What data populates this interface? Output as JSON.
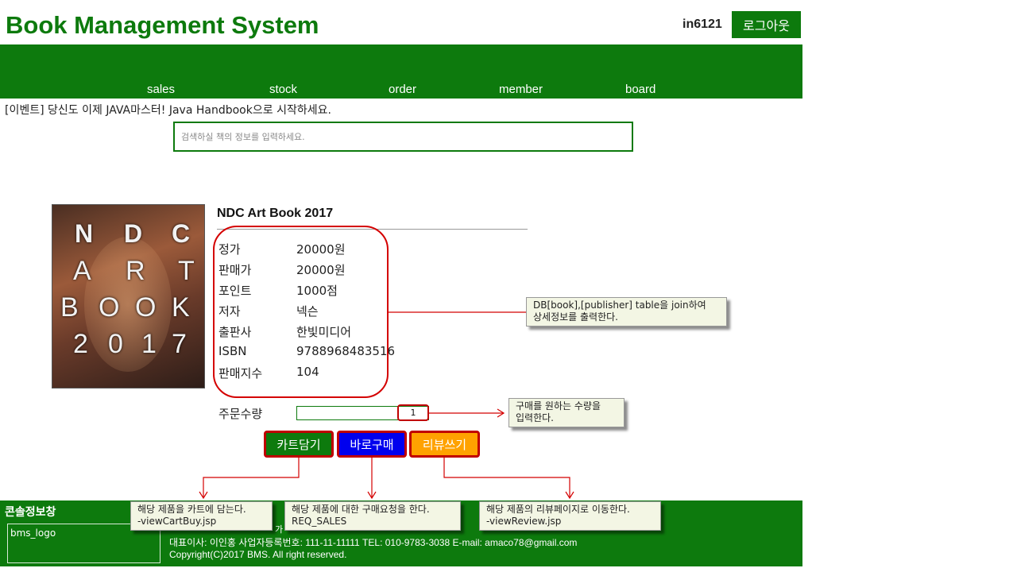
{
  "header": {
    "title": "Book Management System",
    "user_id": "in6121",
    "logout_label": "로그아웃"
  },
  "nav": {
    "items": [
      "sales",
      "stock",
      "order",
      "member",
      "board"
    ]
  },
  "event_banner": "[이벤트] 당신도 이제 JAVA마스터! Java Handbook으로 시작하세요.",
  "search": {
    "placeholder": "검색하실 책의 정보를 입력하세요."
  },
  "book": {
    "cover_letters": [
      "N",
      "D",
      "C",
      "A",
      "R",
      "T",
      "B",
      "O",
      "O",
      "K",
      "2",
      "0",
      "1",
      "7"
    ],
    "title": "NDC Art Book 2017",
    "fields": [
      {
        "label": "정가",
        "value": "20000원"
      },
      {
        "label": "판매가",
        "value": "20000원"
      },
      {
        "label": "포인트",
        "value": "1000점"
      },
      {
        "label": "저자",
        "value": "넥슨"
      },
      {
        "label": "출판사",
        "value": "한빛미디어"
      },
      {
        "label": "ISBN",
        "value": "9788968483516"
      },
      {
        "label": "판매지수",
        "value": "104"
      }
    ],
    "qty_label": "주문수량",
    "qty_value": "1"
  },
  "buttons": {
    "cart": "카트담기",
    "buy": "바로구매",
    "review": "리뷰쓰기"
  },
  "annotations": {
    "db_note_1": "DB[book],[publisher] table을 join하여",
    "db_note_2": "상세정보를 출력한다.",
    "qty_note_1": "구매를 원하는 수량을",
    "qty_note_2": "입력한다.",
    "cart_note_1": "해당 제품을 카트에 담는다.",
    "cart_note_2": "-viewCartBuy.jsp",
    "buy_note_1": "해당 제품에 대한 구매요청을 한다.",
    "buy_note_2": "REQ_SALES",
    "review_note_1": "해당 제품의 리뷰페이지로 이동한다.",
    "review_note_2": "-viewReview.jsp"
  },
  "footer": {
    "console_label": "콘솔정보창",
    "logo_label": "bms_logo",
    "partial_text": "가",
    "company_line": "대표이사: 이인홍 사업자등록번호: 111-11-11111 TEL: 010-9783-3038 E-mail: amaco78@gmail.com",
    "copyright": "Copyright(C)2017 BMS. All right reserved."
  },
  "colors": {
    "brand_green": "#0d7a0d",
    "highlight_red": "#d40000",
    "buy_blue": "#0000ee",
    "review_orange": "#ffa200"
  }
}
